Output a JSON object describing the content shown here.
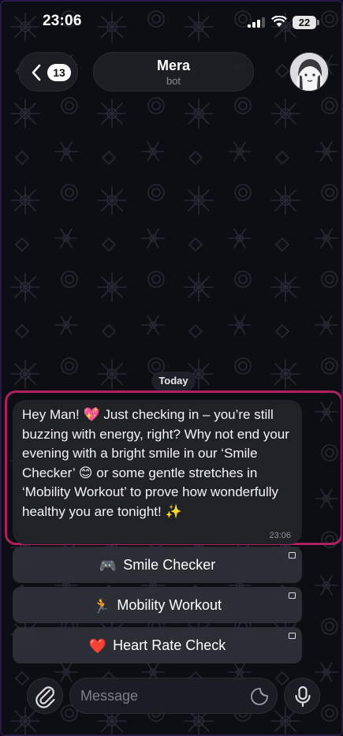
{
  "status_bar": {
    "time": "23:06",
    "battery": "22"
  },
  "header": {
    "back_badge": "13",
    "chat_name": "Mera",
    "chat_subtitle": "bot"
  },
  "date_separator": "Today",
  "message": {
    "text": "Hey Man! 💖 Just checking in – you’re still buzzing with energy, right? Why not end your evening with a bright smile in our ‘Smile Checker’ 😊 or some gentle stretches in ‘Mobility Workout’ to prove how wonderfully healthy you are tonight! ✨",
    "time": "23:06"
  },
  "keyboard": [
    {
      "icon": "🎮",
      "label": "Smile Checker"
    },
    {
      "icon": "🏃",
      "label": "Mobility Workout"
    },
    {
      "icon": "❤️",
      "label": "Heart Rate Check"
    }
  ],
  "input": {
    "placeholder": "Message"
  },
  "icons": {
    "back": "chevron-left-icon",
    "attach": "paperclip-icon",
    "sticker": "sticker-icon",
    "mic": "microphone-icon"
  },
  "colors": {
    "highlight": "#b0205e",
    "bubble": "#212226",
    "button": "#2e3038"
  }
}
